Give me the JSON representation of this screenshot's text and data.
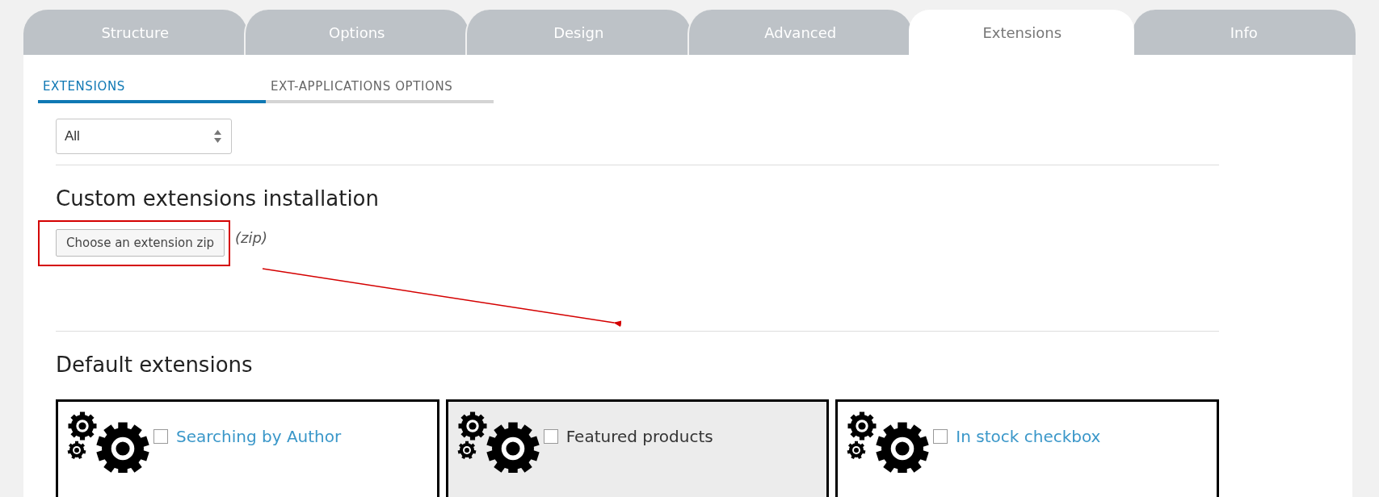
{
  "tabs": [
    {
      "label": "Structure",
      "selected": false
    },
    {
      "label": "Options",
      "selected": false
    },
    {
      "label": "Design",
      "selected": false
    },
    {
      "label": "Advanced",
      "selected": false
    },
    {
      "label": "Extensions",
      "selected": true
    },
    {
      "label": "Info",
      "selected": false
    }
  ],
  "subtabs": [
    {
      "label": "EXTENSIONS",
      "selected": true
    },
    {
      "label": "EXT-APPLICATIONS OPTIONS",
      "selected": false
    }
  ],
  "filter": {
    "value": "All"
  },
  "custom_section": {
    "heading": "Custom extensions installation",
    "button": "Choose an extension zip",
    "hint": "(zip)"
  },
  "default_section": {
    "heading": "Default extensions",
    "extensions": [
      {
        "title": "Searching by Author",
        "checked": false,
        "active": false
      },
      {
        "title": "Featured products",
        "checked": false,
        "active": true
      },
      {
        "title": "In stock checkbox",
        "checked": false,
        "active": false
      }
    ]
  }
}
